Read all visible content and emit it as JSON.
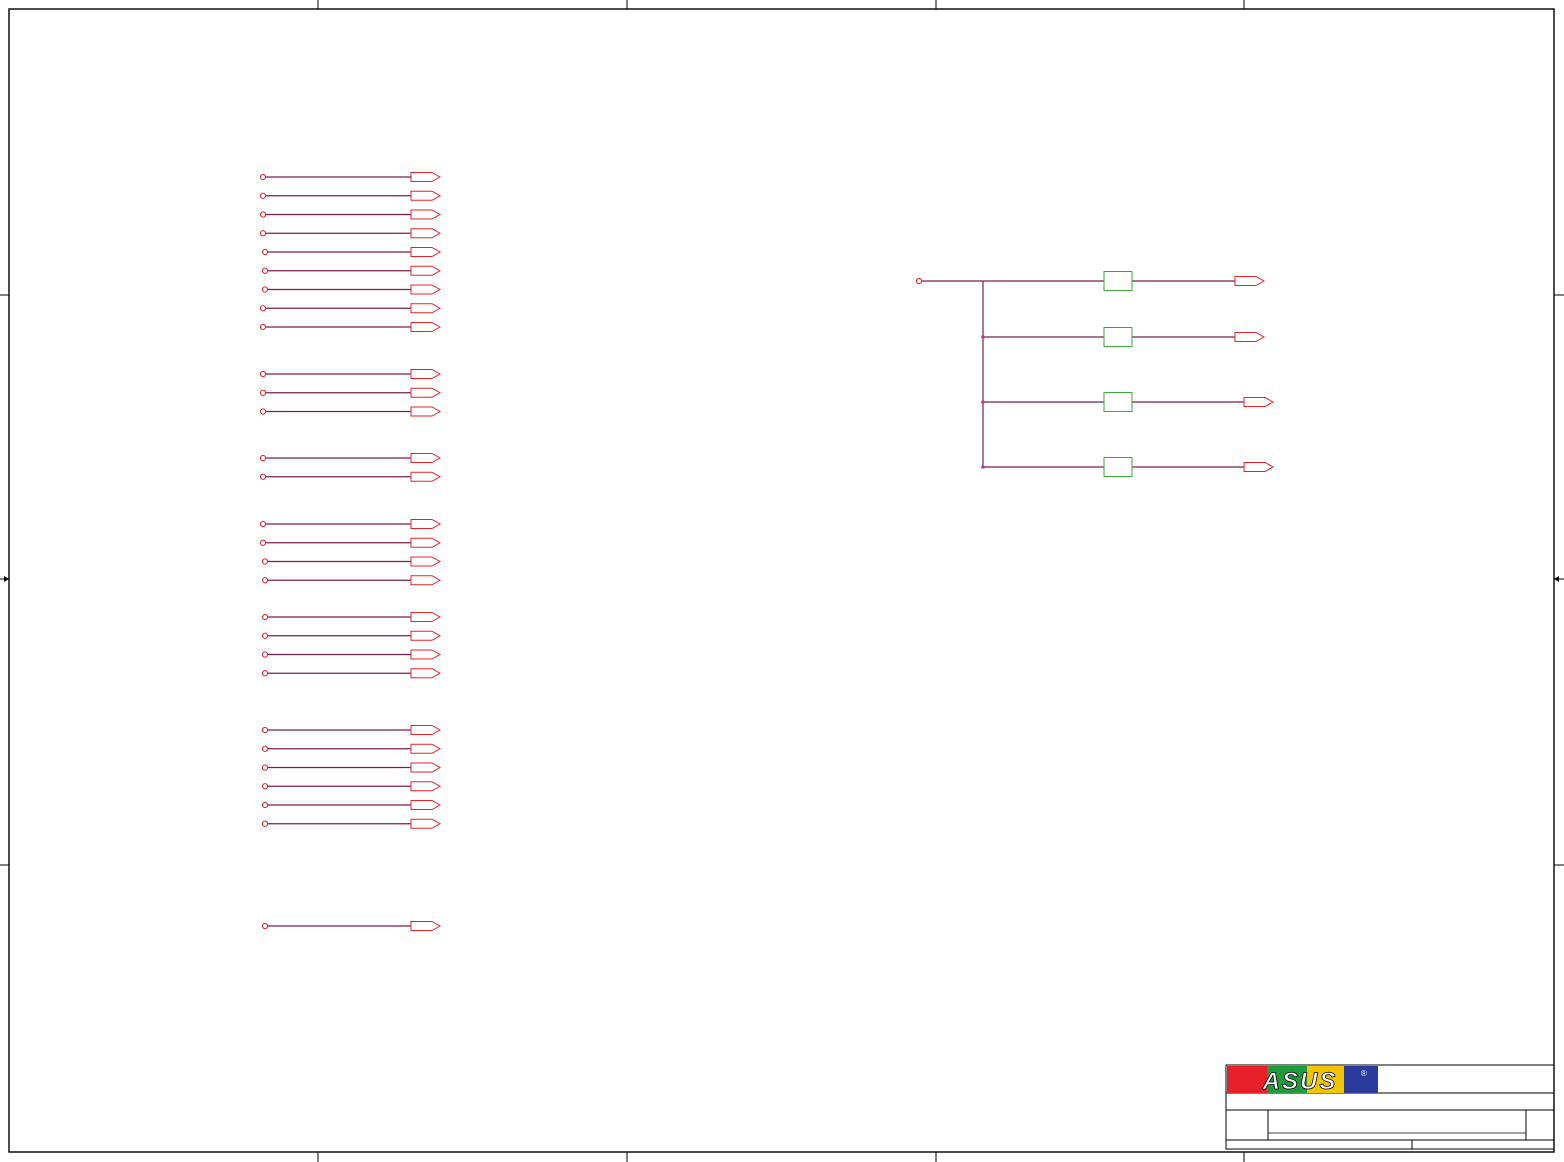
{
  "schematic": {
    "title_block": {
      "logo_text": "ASUS",
      "logo_mark": "®",
      "logo_colors": [
        "#e8202a",
        "#1e9b3c",
        "#f2c400",
        "#2a3b9b"
      ]
    },
    "colors": {
      "wire": "#7a1f4a",
      "pin": "#e8202a",
      "component": "#3aa83a",
      "frame": "#000000"
    },
    "left_net_groups": [
      {
        "count": 9
      },
      {
        "count": 3
      },
      {
        "count": 2
      },
      {
        "count": 4
      },
      {
        "count": 4
      },
      {
        "count": 6
      },
      {
        "count": 1
      }
    ],
    "right_circuit": {
      "branches": 4
    }
  }
}
